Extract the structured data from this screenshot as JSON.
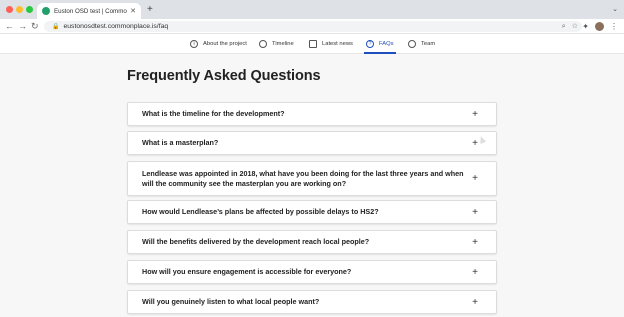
{
  "browser": {
    "tab_title": "Euston OSD test | Commonplace",
    "url": "eustonosdtest.commonplace.is/faq"
  },
  "sitenav": {
    "items": [
      {
        "label": "About the project",
        "icon": "info-circle-icon"
      },
      {
        "label": "Timeline",
        "icon": "clock-icon"
      },
      {
        "label": "Latest news",
        "icon": "news-icon"
      },
      {
        "label": "FAQs",
        "icon": "question-circle-icon",
        "active": true
      },
      {
        "label": "Team",
        "icon": "team-icon"
      }
    ]
  },
  "page": {
    "title": "Frequently Asked Questions"
  },
  "faqs": [
    {
      "question": "What is the timeline for the development?",
      "icon": "+"
    },
    {
      "question": "What is a masterplan?",
      "icon": "+"
    },
    {
      "question": "Lendlease was appointed in 2018, what have you been doing for the last three years and when will the community see the masterplan you are working on?",
      "icon": "+"
    },
    {
      "question": "How would Lendlease’s plans be affected by possible delays to HS2?",
      "icon": "+"
    },
    {
      "question": "Will the benefits delivered by the development reach local people?",
      "icon": "+"
    },
    {
      "question": "How will you ensure engagement is accessible for everyone?",
      "icon": "+"
    },
    {
      "question": "Will you genuinely listen to what local people want?",
      "icon": "+"
    }
  ],
  "colors": {
    "accent": "#1f4fbf",
    "page_bg": "#f7f7f7"
  }
}
